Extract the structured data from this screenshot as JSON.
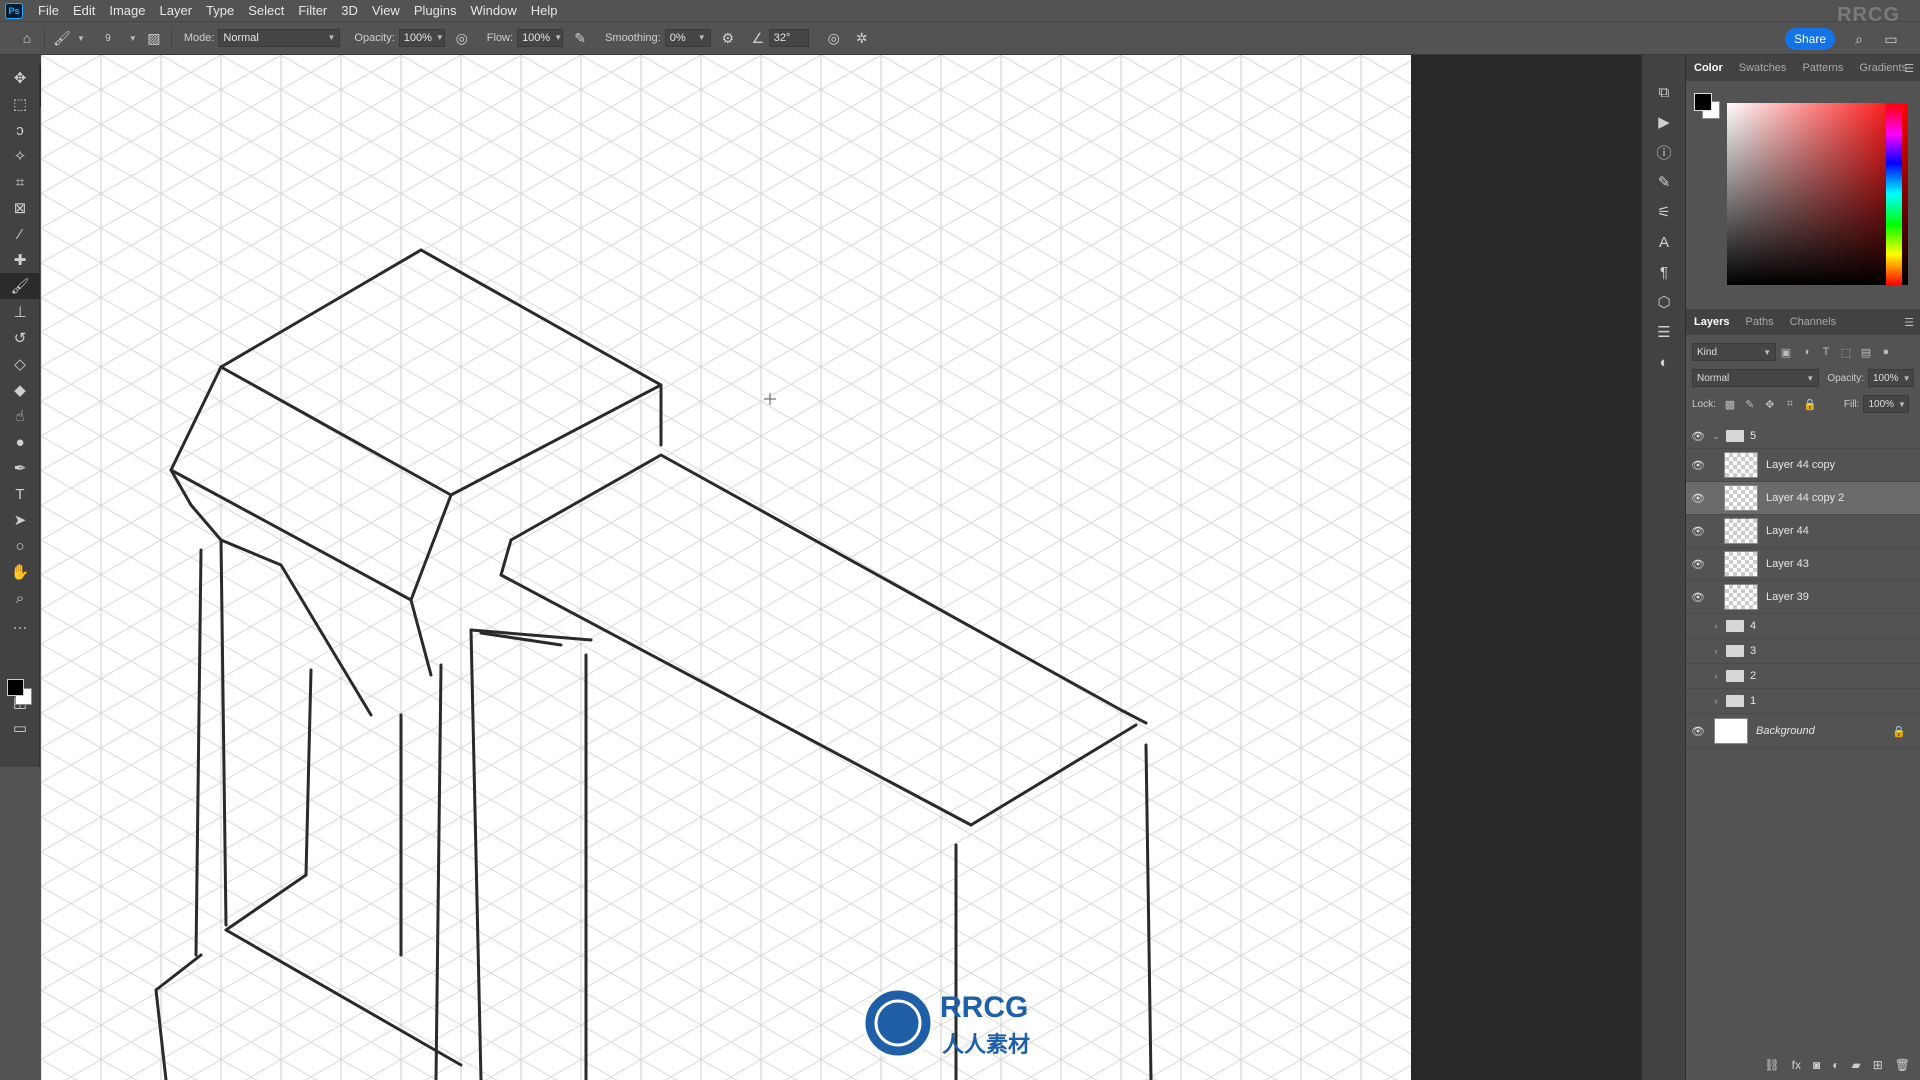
{
  "app": {
    "logo": "Ps",
    "watermark": "RRCG"
  },
  "menu": [
    "File",
    "Edit",
    "Image",
    "Layer",
    "Type",
    "Select",
    "Filter",
    "3D",
    "View",
    "Plugins",
    "Window",
    "Help"
  ],
  "options": {
    "brush_size": "9",
    "mode_label": "Mode:",
    "mode_value": "Normal",
    "opacity_label": "Opacity:",
    "opacity_value": "100%",
    "flow_label": "Flow:",
    "flow_value": "100%",
    "smoothing_label": "Smoothing:",
    "smoothing_value": "0%",
    "angle_value": "32°",
    "share_label": "Share"
  },
  "color_panel": {
    "tabs": [
      "Color",
      "Swatches",
      "Patterns",
      "Gradients"
    ],
    "foreground": "#000000",
    "background": "#ffffff",
    "hue": "#ff0000"
  },
  "layers_panel": {
    "tabs": [
      "Layers",
      "Paths",
      "Channels"
    ],
    "filter_kind": "Kind",
    "blend_mode": "Normal",
    "opacity_label": "Opacity:",
    "opacity_value": "100%",
    "lock_label": "Lock:",
    "fill_label": "Fill:",
    "fill_value": "100%",
    "layers": [
      {
        "name": "5",
        "type": "group",
        "visible": true,
        "expanded": true
      },
      {
        "name": "Layer 44 copy",
        "type": "layer",
        "visible": true
      },
      {
        "name": "Layer 44 copy 2",
        "type": "layer",
        "visible": true,
        "selected": true
      },
      {
        "name": "Layer 44",
        "type": "layer",
        "visible": true
      },
      {
        "name": "Layer 43",
        "type": "layer",
        "visible": true
      },
      {
        "name": "Layer 39",
        "type": "layer",
        "visible": true
      },
      {
        "name": "4",
        "type": "group",
        "visible": false
      },
      {
        "name": "3",
        "type": "group",
        "visible": false
      },
      {
        "name": "2",
        "type": "group",
        "visible": false
      },
      {
        "name": "1",
        "type": "group",
        "visible": false
      },
      {
        "name": "Background",
        "type": "background",
        "visible": true,
        "locked": true
      }
    ]
  },
  "watermark_logo": {
    "line1": "RRCG",
    "line2": "人人素材"
  }
}
